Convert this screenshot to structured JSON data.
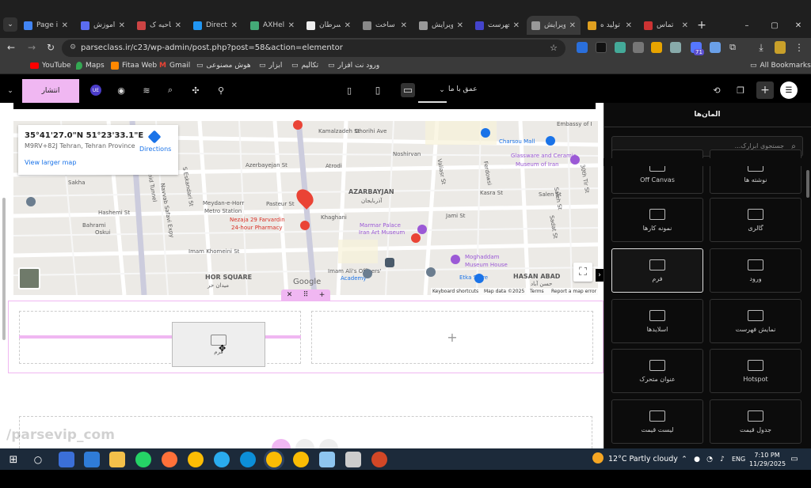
{
  "browser": {
    "tabs": [
      {
        "label": "Page i",
        "color": "#4285f4"
      },
      {
        "label": "آموزش",
        "color": "#5b6cf0"
      },
      {
        "label": "ناحیه ک",
        "color": "#c44"
      },
      {
        "label": "Directi",
        "color": "#2196f3"
      },
      {
        "label": "AXHel",
        "color": "#4a7"
      },
      {
        "label": "سرطان",
        "color": "#eee"
      },
      {
        "label": "ساخت",
        "color": "#888"
      },
      {
        "label": "ویرایش",
        "color": "#999"
      },
      {
        "label": "فهرست",
        "color": "#4444cc"
      },
      {
        "label": "ویرایش",
        "color": "#999"
      },
      {
        "label": "تولید ه",
        "color": "#e0a020"
      },
      {
        "label": "تماس",
        "color": "#c33"
      }
    ],
    "url": "parseclass.ir/c23/wp-admin/post.php?post=58&action=elementor",
    "bookmarks": [
      "YouTube",
      "Maps",
      "Fitaa Web",
      "Gmail",
      "هوش مصنوعی",
      "ابزار",
      "تکالیم",
      "ورود نت افزار"
    ],
    "all_bookmarks": "All Bookmarks",
    "ext_badge": "71"
  },
  "editor": {
    "publish": "انتشار",
    "device_menu": "عمق با ما",
    "panel_title": "المان‌ها",
    "search_placeholder": "جستجوی ابزارک...",
    "widgets": [
      {
        "label": "نوشته ها"
      },
      {
        "label": "Off Canvas"
      },
      {
        "label": "گالری"
      },
      {
        "label": "نمونه کارها"
      },
      {
        "label": "ورود"
      },
      {
        "label": "فرم"
      },
      {
        "label": "نمایش فهرست"
      },
      {
        "label": "اسلایدها"
      },
      {
        "label": "Hotspot"
      },
      {
        "label": "عنوان متحرک"
      },
      {
        "label": "جدول قیمت"
      },
      {
        "label": "لیست قیمت"
      }
    ],
    "drag_label": "فرم",
    "watermark": "/parsevip_com"
  },
  "map": {
    "coords": "35°41'27.0\"N 51°23'33.1\"E",
    "plus_code": "M9RV+82J Tehran, Tehran Province",
    "directions": "Directions",
    "larger": "View larger map",
    "footer": [
      "Keyboard shortcuts",
      "Map data ©2025",
      "Terms",
      "Report a map error"
    ],
    "google": "Google",
    "labels": [
      "Kamalzadeh St",
      "Azerbayejan St",
      "Atrodi",
      "AZARBAYJAN",
      "آذربایجان",
      "Meydan-e-Horr",
      "Metro Station",
      "Pasteur St",
      "Nezaja 29 Farvardin",
      "24-hour Pharmacy",
      "Khaghani",
      "Marmar Palace",
      "Iran Art Museum",
      "Jami St",
      "Imam Khomeini St",
      "HOR SQUARE",
      "میدان حر",
      "Imam Ali's Officers'",
      "Academy",
      "Etka Store",
      "HASAN ABAD",
      "حسن آباد",
      "Moghaddam",
      "Museum House",
      "Glassware and Ceramic",
      "Museum of Iran",
      "Charsou Mall",
      "Embassy of I",
      "Noshirvan",
      "Ghorihi Ave",
      "Hashemi St",
      "Salen St",
      "Sakha",
      "Bahrami",
      "Oskui",
      "Kasra St",
      "Saleh St",
      "Sadat St",
      "30th Tir St",
      "Valiasr St",
      "Ferdowsi",
      "Tohid Tunnel",
      "Navvab Safavi Expy",
      "S Eskandari St"
    ]
  },
  "taskbar": {
    "weather": "12°C  Partly cloudy",
    "lang": "ENG",
    "time": "7:10 PM",
    "date": "11/29/2025"
  }
}
